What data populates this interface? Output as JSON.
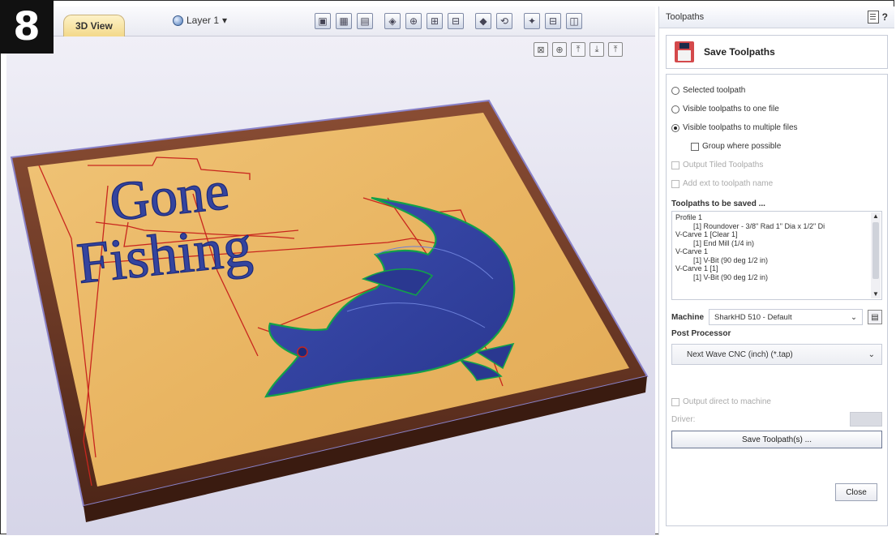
{
  "step_badge": "8",
  "view": {
    "tab_label": "3D View",
    "layer_label": "Layer 1",
    "toolbar_icons": [
      "layout-icon",
      "grid-icon",
      "tiles-icon",
      "diamond-icon",
      "zoom-icon",
      "zoom-fit-icon",
      "zoom-box-icon",
      "render-icon",
      "rotate-icon",
      "gem-icon",
      "split-h-icon",
      "split-v-icon"
    ],
    "view_icons": [
      "iso-view-icon",
      "axes-icon",
      "z-view-icon",
      "x-view-icon",
      "y-view-icon"
    ],
    "view_icon_glyphs": [
      "⊠",
      "⊕",
      "⤒",
      "⤓",
      "⤒"
    ],
    "plaque": {
      "text_line1": "Gone",
      "text_line2": "Fishing",
      "colors": {
        "wood": "#e8b865",
        "border": "#6b3a2a",
        "carve": "#2e3e9e",
        "toolpath": "#c8261e"
      }
    }
  },
  "panel": {
    "header_title": "Toolpaths",
    "header_help": "?",
    "title": "Save Toolpaths",
    "options": [
      {
        "label": "Selected toolpath",
        "selected": false
      },
      {
        "label": "Visible toolpaths to one file",
        "selected": false
      },
      {
        "label": "Visible toolpaths to multiple files",
        "selected": true
      }
    ],
    "group_where_possible": "Group where possible",
    "output_tiled": "Output Tiled Toolpaths",
    "add_ext": "Add ext to toolpath name",
    "to_be_saved_title": "Toolpaths to be saved ...",
    "toolpath_list": [
      {
        "text": "Profile 1",
        "sub": false
      },
      {
        "text": "[1] Roundover - 3/8\" Rad 1\" Dia x 1/2\" Di",
        "sub": true
      },
      {
        "text": "V-Carve 1 [Clear 1]",
        "sub": false
      },
      {
        "text": "[1] End Mill (1/4 in)",
        "sub": true
      },
      {
        "text": "V-Carve 1",
        "sub": false
      },
      {
        "text": "[1] V-Bit (90 deg 1/2 in)",
        "sub": true
      },
      {
        "text": "V-Carve 1 [1]",
        "sub": false
      },
      {
        "text": "[1] V-Bit (90 deg 1/2 in)",
        "sub": true
      }
    ],
    "machine_label": "Machine",
    "machine_value": "SharkHD 510 - Default",
    "post_processor_label": "Post Processor",
    "post_processor_value": "Next Wave CNC (inch) (*.tap)",
    "output_direct": "Output direct to machine",
    "driver_label": "Driver:",
    "save_button": "Save Toolpath(s) ...",
    "close_button": "Close"
  }
}
